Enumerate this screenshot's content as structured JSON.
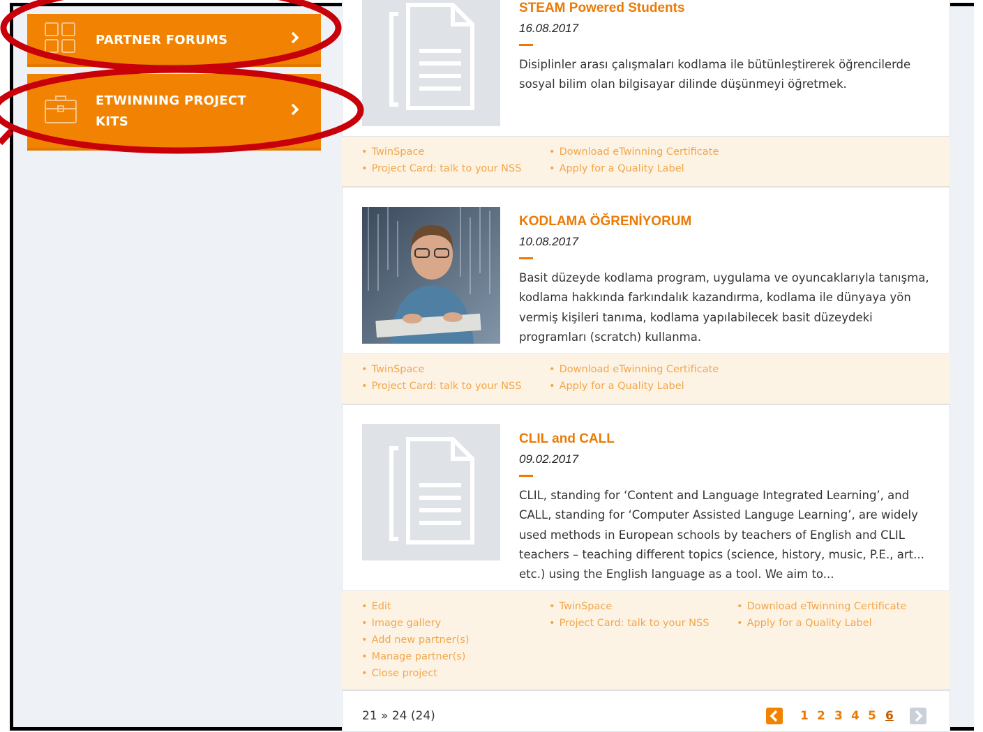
{
  "sidebar": {
    "items": [
      {
        "label": "PARTNER FORUMS",
        "icon": "grid-icon"
      },
      {
        "label": "ETWINNING PROJECT KITS",
        "icon": "briefcase-icon"
      }
    ]
  },
  "projects": [
    {
      "title": "STEAM Powered Students",
      "date": "16.08.2017",
      "description": "Disiplinler arası çalışmaları kodlama ile bütünleştirerek öğrencilerde sosyal bilim olan bilgisayar dilinde düşünmeyi öğretmek.",
      "thumbnail": "document-icon",
      "links_col1": [
        "TwinSpace",
        "Project Card: talk to your NSS"
      ],
      "links_col2": [
        "Download eTwinning Certificate",
        "Apply for a Quality Label"
      ]
    },
    {
      "title": "KODLAMA ÖĞRENİYORUM",
      "date": "10.08.2017",
      "description": "Basit düzeyde kodlama program, uygulama ve oyuncaklarıyla tanışma, kodlama hakkında farkındalık kazandırma, kodlama ile dünyaya yön vermiş kişileri tanıma, kodlama yapılabilecek basit düzeydeki programları (scratch) kullanma.",
      "thumbnail": "photo-boy-keyboard",
      "links_col1": [
        "TwinSpace",
        "Project Card: talk to your NSS"
      ],
      "links_col2": [
        "Download eTwinning Certificate",
        "Apply for a Quality Label"
      ]
    },
    {
      "title": "CLIL and CALL",
      "date": "09.02.2017",
      "description": "CLIL, standing for ‘Content and Language Integrated Learning’, and CALL, standing for ‘Computer Assisted Languge Learning’, are widely used methods in European schools by teachers of English and CLIL teachers – teaching different topics (science, history, music, P.E., art... etc.) using the English language as a tool. We aim to...",
      "thumbnail": "document-icon",
      "links_col1": [
        "Edit",
        "Image gallery",
        "Add new partner(s)",
        "Manage partner(s)",
        "Close project"
      ],
      "links_col2": [
        "TwinSpace",
        "Project Card: talk to your NSS"
      ],
      "links_col3": [
        "Download eTwinning Certificate",
        "Apply for a Quality Label"
      ]
    }
  ],
  "pagination": {
    "summary": "21 » 24 (24)",
    "pages": [
      "1",
      "2",
      "3",
      "4",
      "5",
      "6"
    ],
    "current": "6",
    "prev_icon": "chevron-left-icon",
    "next_icon": "chevron-right-icon"
  },
  "colors": {
    "accent": "#f28302",
    "link": "#f2a64a",
    "annotation": "#c8000a",
    "sidebar_bg": "#eef2f6"
  }
}
